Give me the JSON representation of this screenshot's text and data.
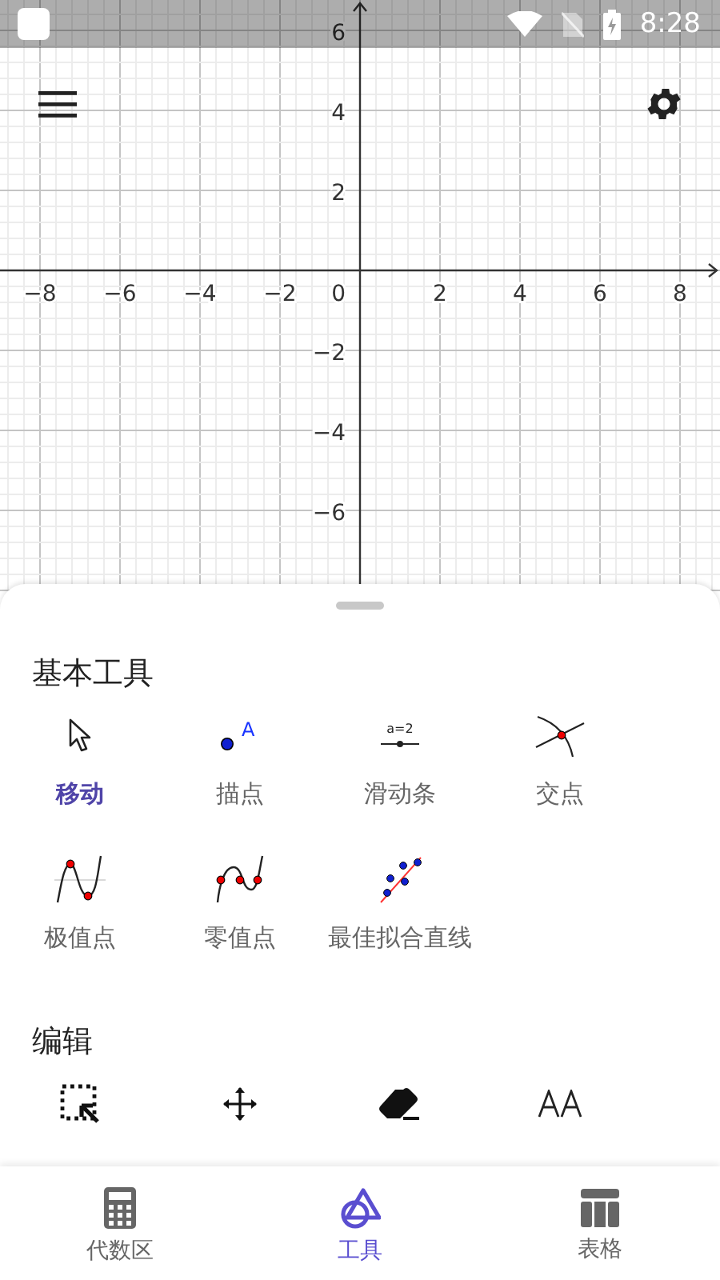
{
  "status_bar": {
    "time": "8:28"
  },
  "graph": {
    "origin_label": "0",
    "x_tick_labels": [
      "−8",
      "−6",
      "−4",
      "−2",
      "2",
      "4",
      "6",
      "8"
    ],
    "y_tick_labels": [
      "6",
      "4",
      "2",
      "−2",
      "−4",
      "−6"
    ]
  },
  "sections": [
    {
      "title": "基本工具",
      "tools": [
        {
          "label": "移动",
          "selected": true
        },
        {
          "label": "描点",
          "selected": false,
          "icon_text": "A"
        },
        {
          "label": "滑动条",
          "selected": false,
          "icon_text": "a=2"
        },
        {
          "label": "交点",
          "selected": false
        },
        {
          "label": "极值点",
          "selected": false
        },
        {
          "label": "零值点",
          "selected": false
        },
        {
          "label": "最佳拟合直线",
          "selected": false
        }
      ]
    },
    {
      "title": "编辑",
      "tools": [
        {
          "selected": false
        },
        {
          "selected": false
        },
        {
          "selected": false
        },
        {
          "selected": false
        }
      ]
    }
  ],
  "bottom_nav": [
    {
      "label": "代数区",
      "selected": false
    },
    {
      "label": "工具",
      "selected": true
    },
    {
      "label": "表格",
      "selected": false
    }
  ]
}
